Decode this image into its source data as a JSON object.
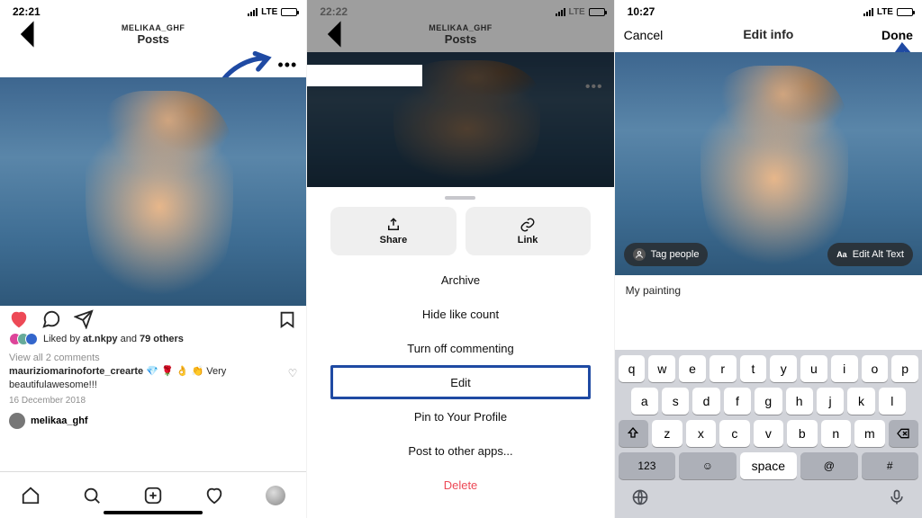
{
  "phone1": {
    "time": "22:21",
    "net": "LTE",
    "username": "MELIKAA_GHF",
    "title": "Posts",
    "likes_prefix": "Liked by ",
    "likes_name": "at.nkpy",
    "likes_and": " and ",
    "likes_rest": "79 others",
    "view_comments": "View all 2 comments",
    "comment_user": "mauriziomarinoforte_crearte",
    "comment_emojis": " 💎 🌹 👌 👏 ",
    "comment_text": "Very beautifulawesome!!!",
    "date": "16 December 2018",
    "next_user": "melikaa_ghf"
  },
  "phone2": {
    "time": "22:22",
    "net": "LTE",
    "username": "MELIKAA_GHF",
    "title": "Posts",
    "share": "Share",
    "link": "Link",
    "menu": [
      "Archive",
      "Hide like count",
      "Turn off commenting",
      "Edit",
      "Pin to Your Profile",
      "Post to other apps..."
    ],
    "delete": "Delete"
  },
  "phone3": {
    "time": "10:27",
    "net": "LTE",
    "cancel": "Cancel",
    "title": "Edit info",
    "done": "Done",
    "tag": "Tag people",
    "alt": "Edit Alt Text",
    "caption": "My painting",
    "row1": [
      "q",
      "w",
      "e",
      "r",
      "t",
      "y",
      "u",
      "i",
      "o",
      "p"
    ],
    "row2": [
      "a",
      "s",
      "d",
      "f",
      "g",
      "h",
      "j",
      "k",
      "l"
    ],
    "row3": [
      "z",
      "x",
      "c",
      "v",
      "b",
      "n",
      "m"
    ],
    "k123": "123",
    "space": "space",
    "at": "@",
    "hash": "#"
  }
}
